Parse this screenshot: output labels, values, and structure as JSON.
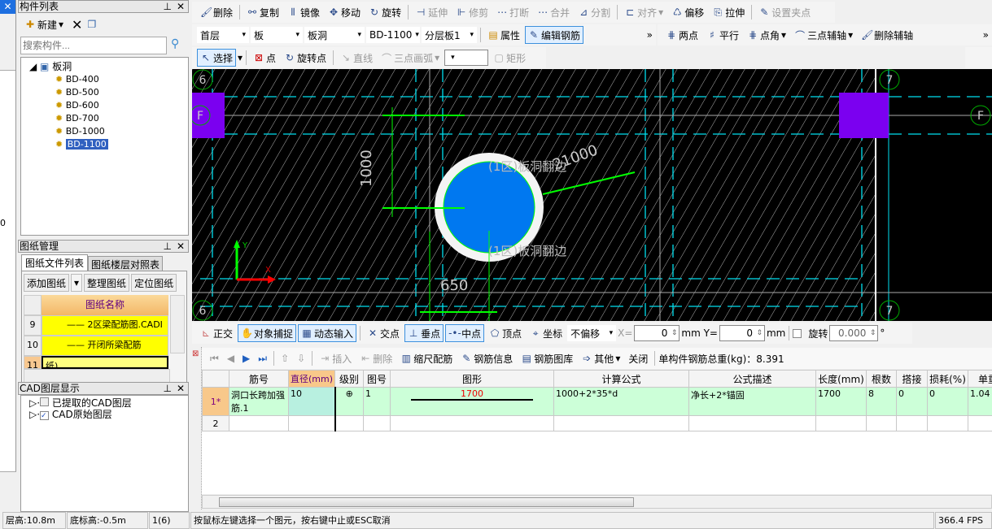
{
  "component_panel": {
    "title": "构件列表",
    "new_label": "新建",
    "search_placeholder": "搜索构件...",
    "tree_root": "板洞",
    "tree_items": [
      "BD-400",
      "BD-500",
      "BD-600",
      "BD-700",
      "BD-1000",
      "BD-1100"
    ],
    "selected": "BD-1100"
  },
  "drawing_panel": {
    "title": "图纸管理",
    "tabs": [
      "图纸文件列表",
      "图纸楼层对照表"
    ],
    "buttons": [
      "添加图纸",
      "整理图纸",
      "定位图纸"
    ],
    "col_header": "图纸名称",
    "rows": [
      {
        "num": "9",
        "name": "2区梁配筋图.CADI"
      },
      {
        "num": "10",
        "name": "开闭所梁配筋图.CADI"
      },
      {
        "num": "11",
        "name": "纸)"
      }
    ]
  },
  "cad_layer_panel": {
    "title": "CAD图层显示",
    "items": [
      {
        "label": "已提取的CAD图层",
        "checked": false
      },
      {
        "label": "CAD原始图层",
        "checked": true
      }
    ]
  },
  "left_strip": {
    "value": "0"
  },
  "toolbar1": [
    "删除",
    "复制",
    "镜像",
    "移动",
    "旋转",
    "延伸",
    "修剪",
    "打断",
    "合并",
    "分割",
    "对齐",
    "偏移",
    "拉伸",
    "设置夹点"
  ],
  "toolbar2": {
    "floor": "首层",
    "type": "板",
    "sub": "板洞",
    "name": "BD-1100",
    "layer": "分层板1",
    "properties": "属性",
    "edit_rebar": "编辑钢筋",
    "aux": [
      "两点",
      "平行",
      "点角",
      "三点辅轴",
      "删除辅轴"
    ]
  },
  "toolbar3": {
    "select": "选择",
    "point": "点",
    "rotate_point": "旋转点",
    "line": "直线",
    "arc": "三点画弧",
    "rect": "矩形"
  },
  "canvas": {
    "axis_labels": [
      "6",
      "7",
      "F"
    ],
    "dim_1000": "1000",
    "dim_21000": "21000",
    "dim_650": "650",
    "label1": "(1区)板洞翻边",
    "label2": "(1区)板洞翻边",
    "axis_x": "X",
    "axis_y": "Y",
    "colors": {
      "bg": "#000000",
      "hole": "#0078f0",
      "column": "#7b00f0",
      "grid": "#00e0f0",
      "rebar": "#00ff00"
    }
  },
  "snap_toolbar": {
    "ortho": "正交",
    "snap": "对象捕捉",
    "dynamic": "动态输入",
    "intersection": "交点",
    "perpendicular": "垂点",
    "midpoint": "中点",
    "vertex": "顶点",
    "coord": "坐标",
    "offset": "不偏移",
    "x_label": "X=",
    "x_value": "0",
    "y_label": "mm Y=",
    "y_value": "0",
    "unit": "mm",
    "rotate": "旋转",
    "rotate_value": "0.000",
    "deg": "°"
  },
  "rebar_toolbar": {
    "insert": "插入",
    "delete": "删除",
    "scale": "缩尺配筋",
    "info": "钢筋信息",
    "library": "钢筋图库",
    "other": "其他",
    "close": "关闭",
    "weight": "单构件钢筋总重(kg)：8.391"
  },
  "rebar_table": {
    "headers": [
      "",
      "筋号",
      "直径(mm)",
      "级别",
      "图号",
      "图形",
      "计算公式",
      "公式描述",
      "长度(mm)",
      "根数",
      "搭接",
      "损耗(%)",
      "单重"
    ],
    "rows": [
      [
        "1*",
        "洞口长跨加强筋.1",
        "10",
        "⊕",
        "1",
        "1700",
        "1000+2*35*d",
        "净长+2*锚固",
        "1700",
        "8",
        "0",
        "0",
        "1.04"
      ],
      [
        "2",
        "",
        "",
        "",
        "",
        "",
        "",
        "",
        "",
        "",
        "",
        "",
        ""
      ]
    ]
  },
  "status": {
    "floor_height": "层高:10.8m",
    "base_height": "底标高:-0.5m",
    "count": "1(6)",
    "hint": "按鼠标左键选择一个图元，按右键中止或ESC取消",
    "fps": "366.4 FPS"
  }
}
